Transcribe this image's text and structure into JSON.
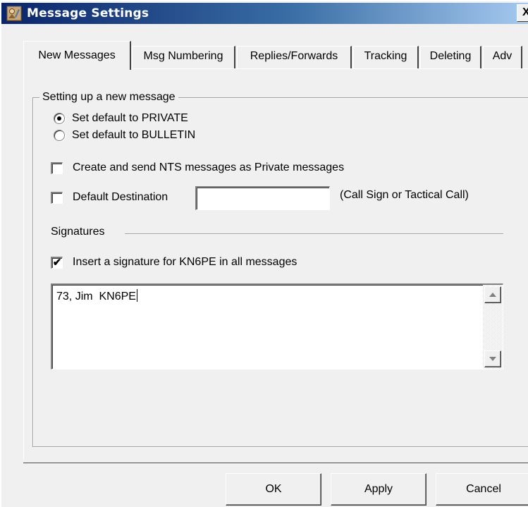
{
  "window": {
    "title": "Message Settings",
    "close_glyph": "X"
  },
  "tabs": [
    {
      "label": "New Messages",
      "active": true
    },
    {
      "label": "Msg Numbering",
      "active": false
    },
    {
      "label": "Replies/Forwards",
      "active": false
    },
    {
      "label": "Tracking",
      "active": false
    },
    {
      "label": "Deleting",
      "active": false
    },
    {
      "label": "Adv",
      "active": false
    }
  ],
  "new_message": {
    "group_title": "Setting up a new message",
    "radio_private": {
      "label": "Set default to PRIVATE",
      "checked": true
    },
    "radio_bulletin": {
      "label": "Set default to BULLETIN",
      "checked": false
    },
    "nts_private": {
      "label": "Create and send NTS messages as Private messages",
      "checked": false
    },
    "default_destination": {
      "label": "Default Destination",
      "checked": false,
      "value": "",
      "hint": "(Call Sign or Tactical Call)"
    }
  },
  "signatures": {
    "section_label": "Signatures",
    "insert_signature": {
      "label": "Insert a signature for KN6PE in all messages",
      "checked": true,
      "check_glyph": "✔"
    },
    "text": "73, Jim  KN6PE"
  },
  "buttons": {
    "ok": "OK",
    "apply": "Apply",
    "cancel": "Cancel"
  }
}
